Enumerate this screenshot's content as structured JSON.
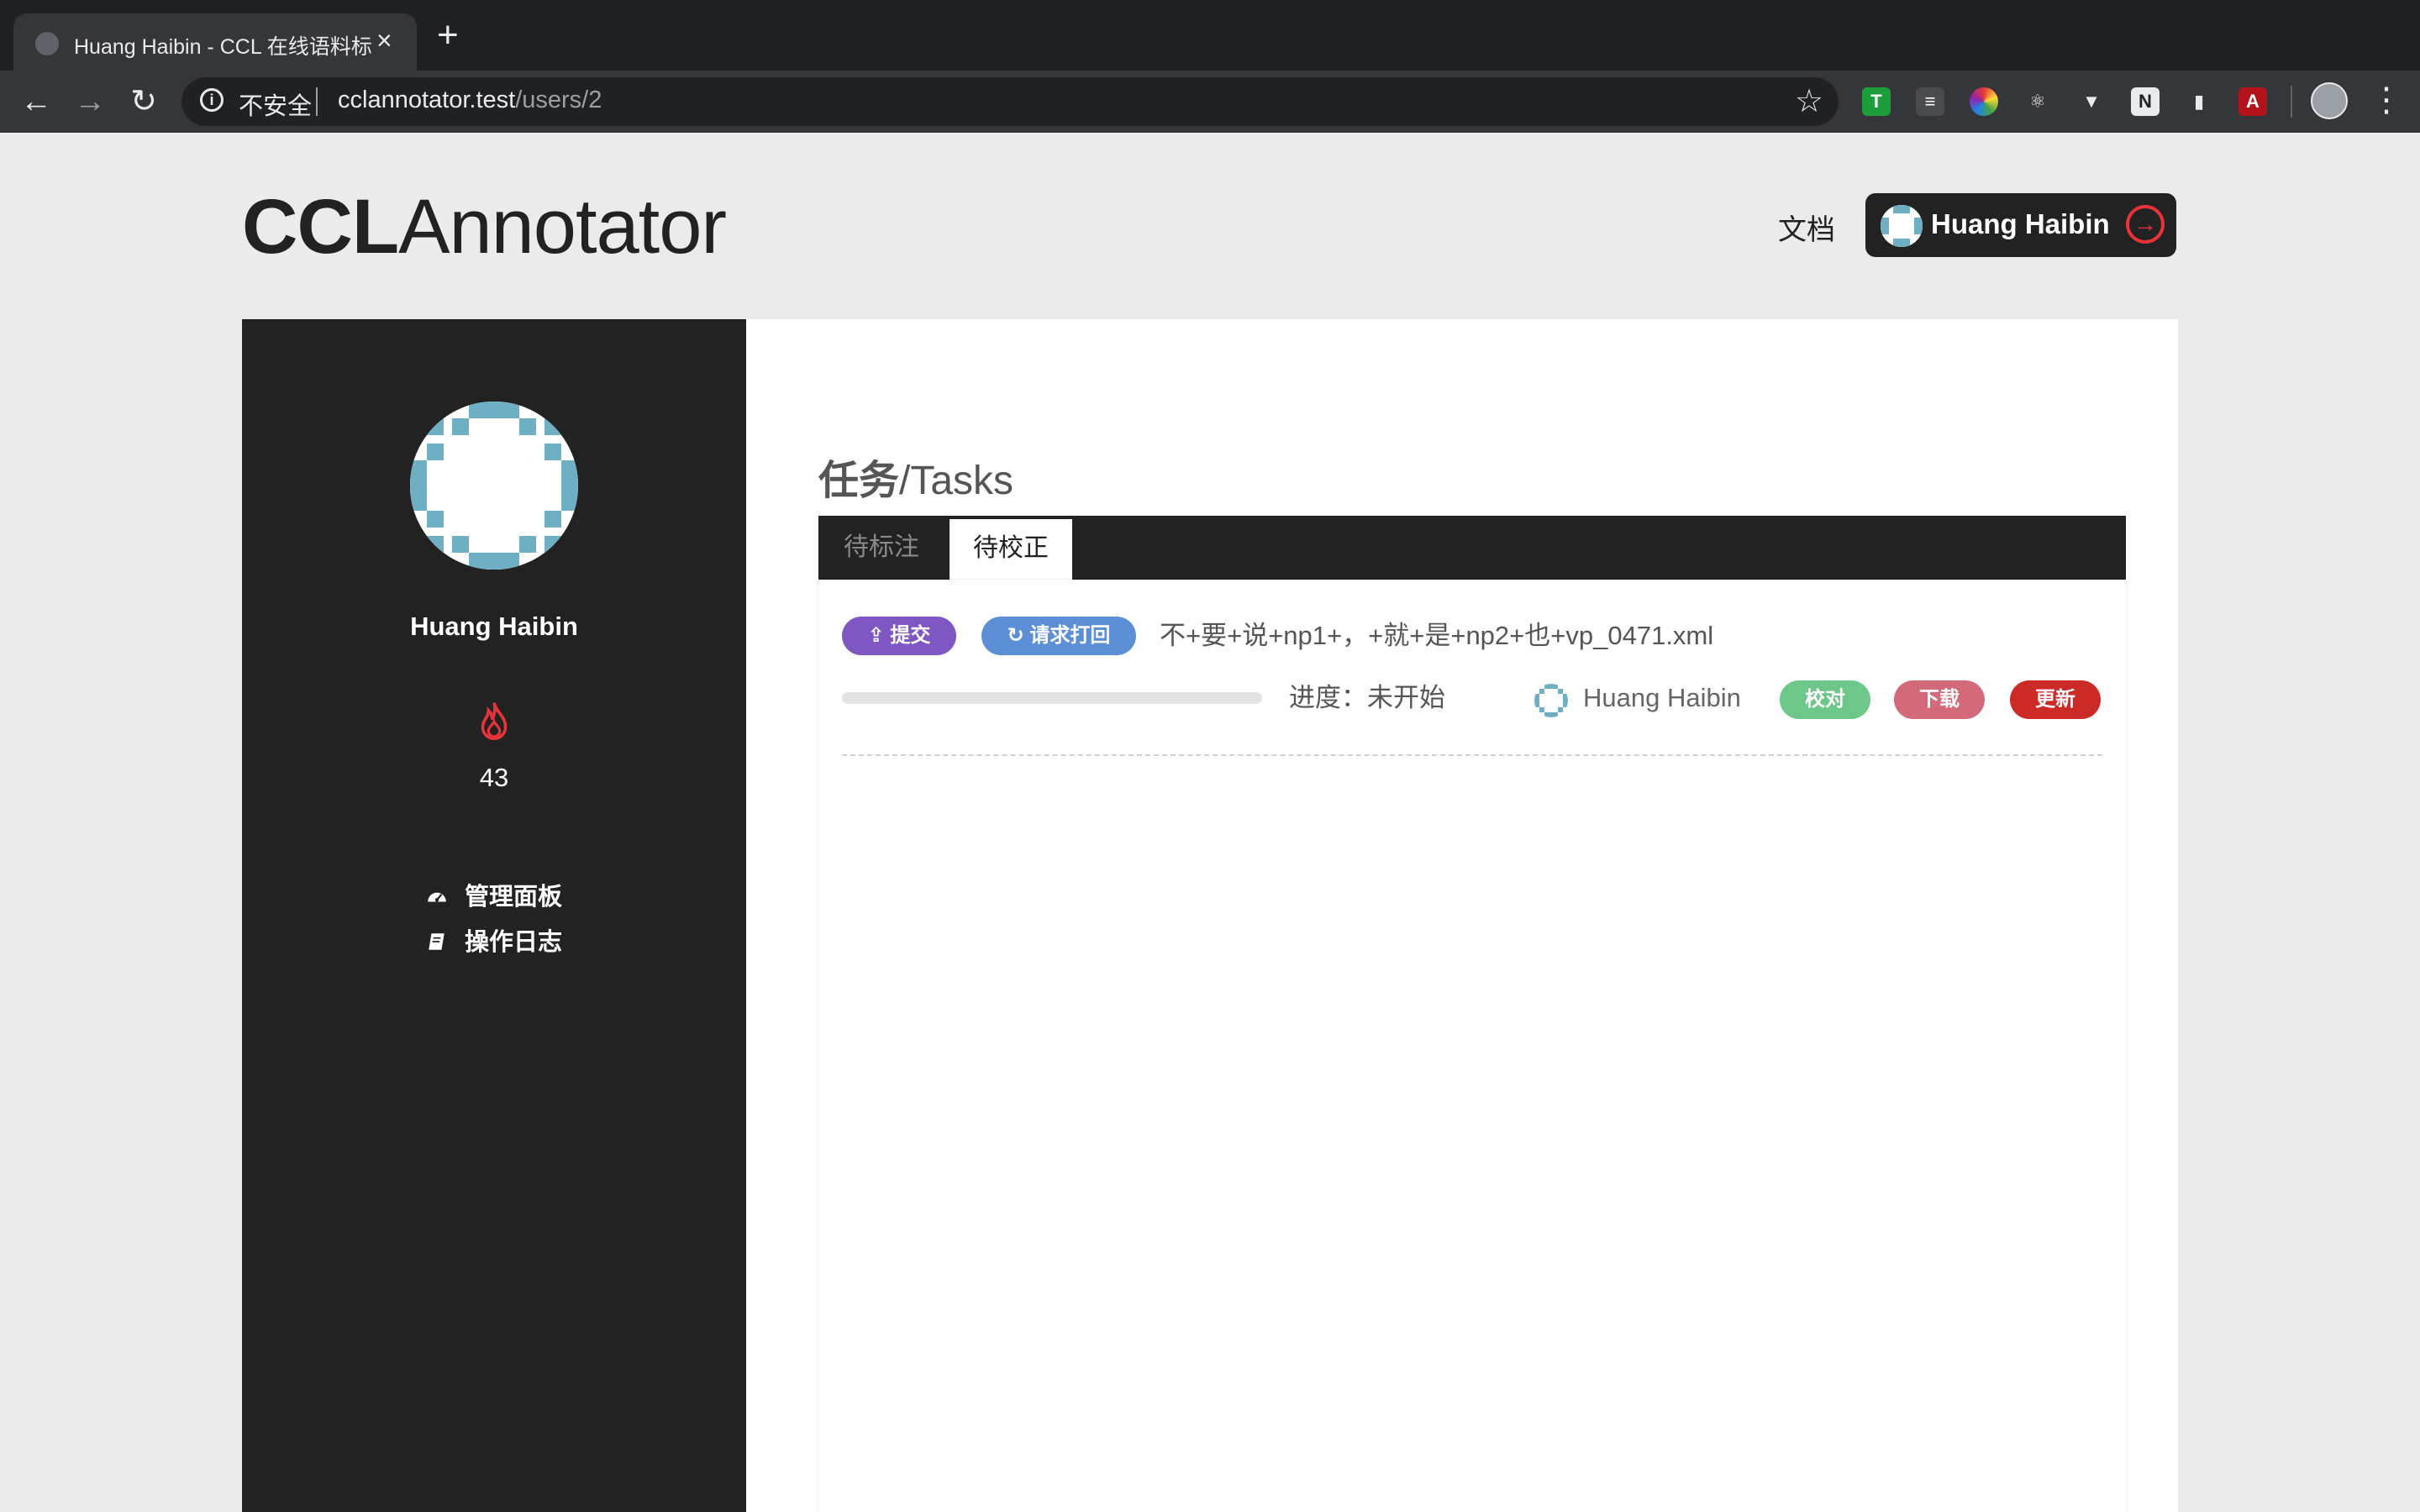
{
  "browser": {
    "tab_title": "Huang Haibin - CCL 在线语料标注",
    "tab_close": "×",
    "new_tab": "+",
    "security_label": "不安全",
    "url_host": "cclannotator.test",
    "url_path": "/users/2",
    "bookmark_star": "☆",
    "menu": "⋮",
    "icons": [
      "back-icon",
      "forward-icon",
      "reload-icon",
      "info-icon",
      "star-icon",
      "extension-icons",
      "profile-avatar",
      "menu-icon"
    ]
  },
  "header": {
    "logo_bold": "CCL",
    "logo_light": "Annotator",
    "docs_link": "文档",
    "user_name": "Huang Haibin"
  },
  "sidebar": {
    "username": "Huang Haibin",
    "score": "43",
    "links": [
      {
        "label": "管理面板",
        "icon": "dashboard-icon"
      },
      {
        "label": "操作日志",
        "icon": "book-icon"
      }
    ]
  },
  "main": {
    "title_zh": "任务",
    "title_en": "/Tasks",
    "tabs": [
      {
        "label": "待标注",
        "active": false
      },
      {
        "label": "待校正",
        "active": true
      }
    ],
    "task": {
      "submit_label": "提交",
      "recall_label": "请求打回",
      "filename": "不+要+说+np1+，+就+是+np2+也+vp_0471.xml",
      "progress_label": "进度：未开始",
      "progress_fraction": 0,
      "assignee": "Huang Haibin",
      "proofread_label": "校对",
      "download_label": "下载",
      "update_label": "更新"
    }
  },
  "colors": {
    "accent_purple": "#7e57c2",
    "accent_blue": "#5c8fd6",
    "green": "#6cc788",
    "pink": "#d36a7a",
    "red": "#cc2a27",
    "dark": "#222222"
  }
}
